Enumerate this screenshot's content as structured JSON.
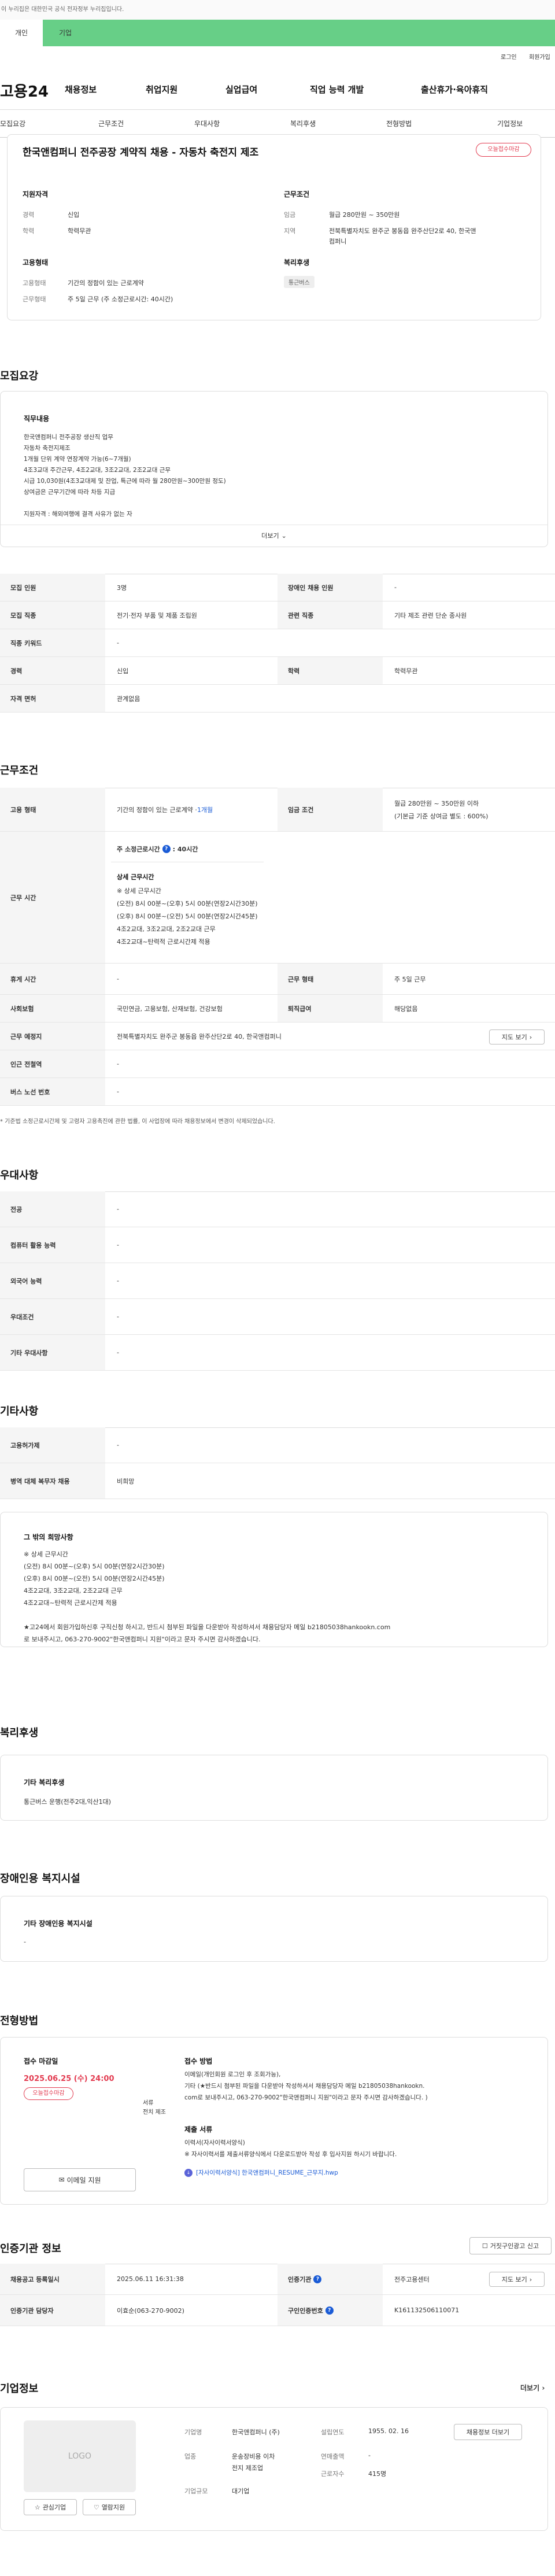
{
  "gov_banner": "이 누리집은 대한민국 공식 전자정부 누리집입니다.",
  "top_tabs": [
    "개인",
    "기업"
  ],
  "util_links": [
    "로그인",
    "회원가입"
  ],
  "logo": "고용24",
  "gnb": [
    "채용정보",
    "취업지원",
    "실업급여",
    "직업 능력 개발",
    "출산휴가·육아휴직"
  ],
  "subnav": [
    "모집요강",
    "근무조건",
    "우대사항",
    "복리후생",
    "전형방법",
    "기업정보"
  ],
  "summary": {
    "title": "한국앤컴퍼니 전주공장 계약직 채용 - 자동차 축전지 제조",
    "badge": "오늘접수마감",
    "applicant_h": "지원자격",
    "career_k": "경력",
    "career_v": "신입",
    "edu_k": "학력",
    "edu_v": "학력무관",
    "work_h": "근무조건",
    "wage_k": "임금",
    "wage_v": "월급 280만원 ~ 350만원",
    "region_k": "지역",
    "region_v1": "전북특별자치도 완주군 봉동읍 완주산단2로 40, 한국앤",
    "region_v2": "컴퍼니",
    "emp_h": "고용형태",
    "emptype_k": "고용형태",
    "emptype_v": "기간의 정함이 있는 근로계약",
    "hours_k": "근무형태",
    "hours_v": "주 5일 근무 (주 소정근로시간: 40시간)",
    "welfare_h": "복리후생",
    "welfare_chip": "통근버스"
  },
  "recruit": {
    "heading": "모집요강",
    "duty_h": "직무내용",
    "duty_text": "한국앤컴퍼니 전주공장 생산직 업무\n자동차 축전지제조\n1개월 단위 계약 연장계약 가능(6~7개월)\n4조3교대 주간근무, 4조2교대, 3조2교대, 2조2교대 근무\n시급 10,030원(4조3교대제 및 잔업, 특근에 따라 월 280만원~300만원 정도)\n상여금은 근무기간에 따라 차등 지급\n\n지원자격 : 해외여행에 결격 사유가 없는 자",
    "more_btn": "더보기",
    "rows": [
      {
        "k1": "모집 인원",
        "v1": "3명",
        "k2": "장애인 채용 인원",
        "v2": "-"
      },
      {
        "k1": "모집 직종",
        "v1": "전기·전자 부품 및 제품 조립원",
        "k2": "관련 직종",
        "v2": "기타 제조 관련 단순 종사원"
      },
      {
        "k1": "직종 키워드",
        "v1": "-"
      },
      {
        "k1": "경력",
        "v1": "신입",
        "k2": "학력",
        "v2": "학력무관"
      },
      {
        "k1": "자격 면허",
        "v1": "관계없음"
      }
    ]
  },
  "conditions": {
    "heading": "근무조건",
    "emp_k": "고용 형태",
    "emp_v": "기간의 정함이 있는 근로계약 · ",
    "emp_v_link": "1개월",
    "wage_k": "임금 조건",
    "wage_v1": "월급 280만원 ~ 350만원 이하",
    "wage_v2": "(기본급 기준 상여금 별도 : 600%)",
    "time_k": "근무 시간",
    "time_week": "주 소정근로시간",
    "time_week_v": ": 40시간",
    "time_detail_h": "상세 근무시간",
    "time_detail": "※ 상세 근무시간\n(오전) 8시 00분~(오후) 5시 00분(연장2시간30분)\n(오후) 8시 00분~(오전) 5시 00분(연장2시간45분)\n4조2교대, 3조2교대, 2조2교대 근무\n4조2교대~탄력적 근로시간제 적용",
    "holiday_k": "휴게 시간",
    "holiday_v": "-",
    "form_k": "근무 형태",
    "form_v": "주 5일 근무",
    "ins_k": "사회보험",
    "ins_v": "국민연금, 고용보험, 산재보험, 건강보험",
    "ret_k": "퇴직급여",
    "ret_v": "해당없음",
    "loc_k": "근무 예정지",
    "loc_v": "전북특별자치도 완주군 봉동읍 완주산단2로 40, 한국앤컴퍼니",
    "map_btn": "지도 보기",
    "sub_k": "인근 전철역",
    "sub_v": "-",
    "bus_k": "버스 노선 번호",
    "bus_v": "-",
    "note": "* 기준법 소정근로시간제 및 고령자 고용촉진에 관한 법률, 이 사업장에 따라 채용정보에서 변경이 삭제되었습니다."
  },
  "pref": {
    "heading": "우대사항",
    "rows": [
      {
        "k": "전공",
        "v": "-"
      },
      {
        "k": "컴퓨터 활용 능력",
        "v": "-"
      },
      {
        "k": "외국어 능력",
        "v": "-"
      },
      {
        "k": "우대조건",
        "v": "-"
      },
      {
        "k": "기타 우대사항",
        "v": "-"
      }
    ]
  },
  "etc": {
    "heading": "기타사항",
    "rows": [
      {
        "k": "고용허가제",
        "v": "-"
      },
      {
        "k": "병역 대체 복무자 채용",
        "v": "비희망"
      }
    ],
    "box_h": "그 밖의 희망사항",
    "box_text": "※ 상세 근무시간\n(오전) 8시 00분~(오후) 5시 00분(연장2시간30분)\n(오후) 8시 00분~(오전) 5시 00분(연장2시간45분)\n4조2교대, 3조2교대, 2조2교대 근무\n4조2교대~탄력적 근로시간제 적용\n\n★고24에서 회원가입하신후 구직신청 하시고, 반드시 첨부된 파일을 다운받아 작성하셔서 채용담당자 메일 b21805038hankookn.com\n로 보내주시고, 063-270-9002\"한국앤컴퍼니 지원\"이라고 문자 주시면 감사하겠습니다."
  },
  "welfare": {
    "heading": "복리후생",
    "box_h": "기타 복리후생",
    "box_v": "통근버스 운행(전주2대,익산1대)"
  },
  "disabled": {
    "heading": "장애인용 복지시설",
    "box_h": "기타 장애인용 복지시설",
    "box_v": "-"
  },
  "process": {
    "heading": "전형방법",
    "deadline_h": "접수 마감일",
    "deadline_v": "2025.06.25 (수) 24:00",
    "deadline_badge": "오늘접수마감",
    "email_btn": "이메일 지원",
    "method_h": "접수 방법",
    "method_text": "이메일(개인회원 로그인 후 조회가능),\n기타 (★반드시 첨부된 파일을 다운받아 작성하셔서 채용담당자 메일 b21805038hankookn.\ncom로 보내주시고, 063-270-9002\"한국앤컴퍼니 지원\"이라고 문자 주시면 감사하겠습니다. )",
    "process_text": "서류\n전치 제조",
    "docs_h": "제출 서류",
    "docs_text": "이력서(자사이력서양식)\n※ 자사이력서를 제출서류양식에서 다운로드받아 작성 후 입사지원 하시기 바랍니다.",
    "file_link": "[자사이력서양식] 한국앤컴퍼니_RESUME_근무지.hwp"
  },
  "auth": {
    "heading": "인증기관 정보",
    "report_btn": "거짓구인광고 신고",
    "reg_k": "채용공고 등록일시",
    "reg_v": "2025.06.11 16:31:38",
    "org_k": "인증기관",
    "org_v": "전주고용센터",
    "map_btn": "지도 보기",
    "mgr_k": "인증기관 담당자",
    "mgr_v": "이효순(063-270-9002)",
    "no_k": "구인인증번호",
    "no_v": "K161132506110071"
  },
  "company": {
    "heading": "기업정보",
    "more": "더보기",
    "logo": "LOGO",
    "fav_btn": "관심기업",
    "cmp_btn": "열람지원",
    "name_k": "기업명",
    "name_v": "한국앤컴퍼니 (주)",
    "est_k": "설립연도",
    "est_v": "1955. 02. 16",
    "industry_k": "업종",
    "industry_v1": "운송장비용 이차",
    "industry_v2": "전지 제조업",
    "sales_k": "연매출액",
    "sales_v": "-",
    "emp_k": "근로자수",
    "emp_v": "415명",
    "size_k": "기업규모",
    "size_v": "대기업",
    "jobs_btn": "채용정보 더보기"
  },
  "colors": {
    "brand_green": "#67cf87",
    "badge_red": "#e23a4f",
    "link_blue": "#1a5bd6"
  }
}
